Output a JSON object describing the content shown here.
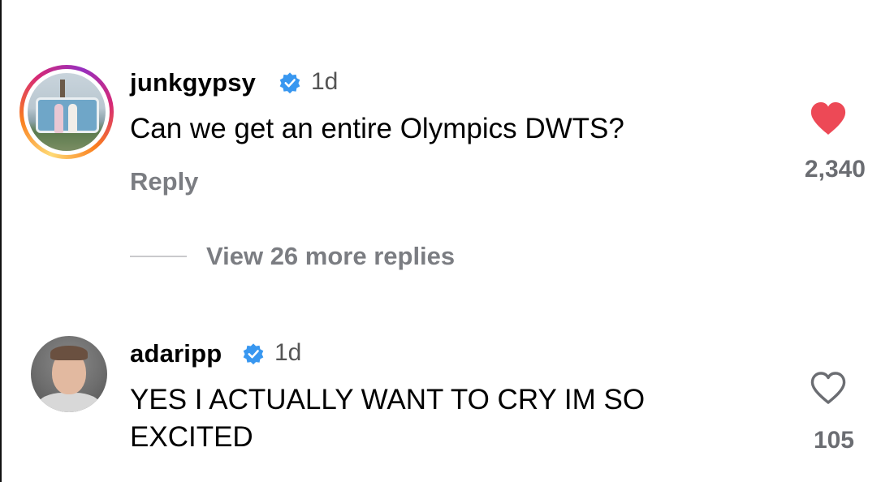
{
  "comments": [
    {
      "username": "junkgypsy",
      "verified": true,
      "time": "1d",
      "text": "Can we get an entire Olympics DWTS?",
      "reply_label": "Reply",
      "liked": true,
      "like_count": "2,340",
      "avatar_has_story_ring": true
    },
    {
      "username": "adaripp",
      "verified": true,
      "time": "1d",
      "text": "YES I ACTUALLY WANT TO CRY IM SO EXCITED",
      "liked": false,
      "like_count": "105"
    }
  ],
  "view_replies_label": "View 26 more replies",
  "icons": {
    "verified": "verified-badge-icon",
    "liked": "heart-filled-icon",
    "unliked": "heart-outline-icon"
  },
  "colors": {
    "verified_blue": "#3897f0",
    "heart_red": "#ed4956",
    "secondary_text": "#7b7d82"
  }
}
